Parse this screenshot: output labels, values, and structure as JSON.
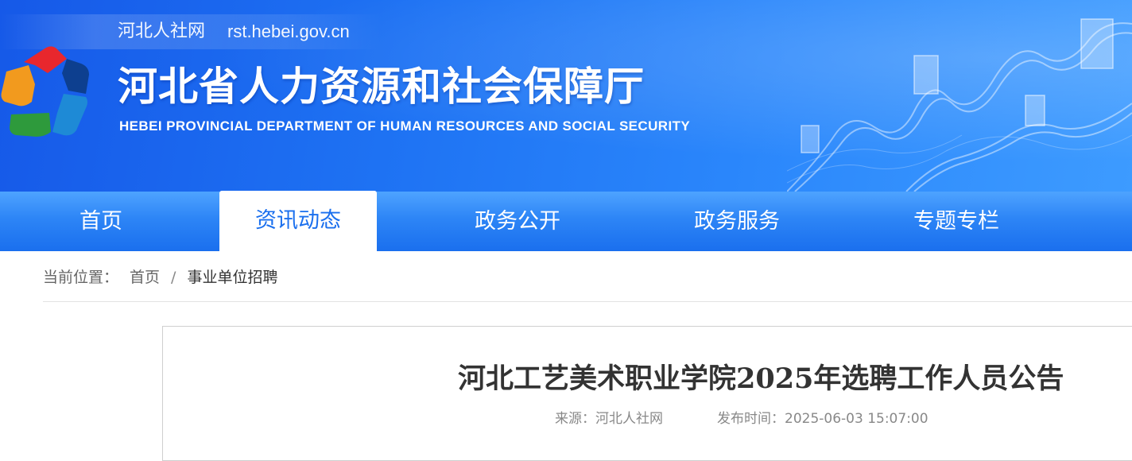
{
  "header": {
    "site_name": "河北人社网",
    "site_url": "rst.hebei.gov.cn",
    "org_title": "河北省人力资源和社会保障厅",
    "org_subtitle": "HEBEI PROVINCIAL DEPARTMENT OF HUMAN RESOURCES AND SOCIAL SECURITY",
    "logo_icon": "provincial-pentagon-logo-icon",
    "decoration_icon": "great-wall-illustration-icon"
  },
  "nav": {
    "items": [
      {
        "label": "首页",
        "active": false
      },
      {
        "label": "资讯动态",
        "active": true
      },
      {
        "label": "政务公开",
        "active": false
      },
      {
        "label": "政务服务",
        "active": false
      },
      {
        "label": "专题专栏",
        "active": false
      }
    ]
  },
  "breadcrumb": {
    "prefix": "当前位置：",
    "home": "首页",
    "separator": "/",
    "current": "事业单位招聘"
  },
  "article": {
    "title": "河北工艺美术职业学院2025年选聘工作人员公告",
    "source": "来源：河北人社网",
    "published": "发布时间：2025-06-03 15:07:00"
  },
  "colors": {
    "banner_blue": "#1e72f3",
    "nav_blue": "#2d85f6",
    "active_text": "#1a6fee",
    "logo_red": "#e8272d",
    "logo_navy": "#0d3f8f",
    "logo_orange": "#f29a1e",
    "logo_green": "#2e9a3c",
    "logo_blue": "#1e8ad6"
  }
}
